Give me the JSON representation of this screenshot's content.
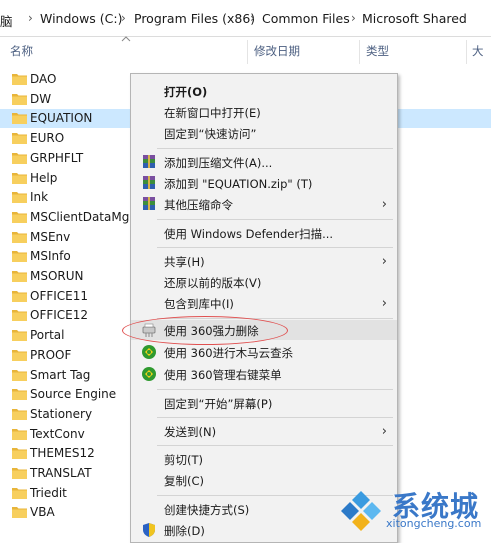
{
  "breadcrumb": [
    "脑",
    "Windows (C:)",
    "Program Files (x86)",
    "Common Files",
    "Microsoft Shared"
  ],
  "columns": {
    "name": "名称",
    "date": "修改日期",
    "type": "类型",
    "size": "大"
  },
  "folders": [
    "DAO",
    "DW",
    "EQUATION",
    "EURO",
    "GRPHFLT",
    "Help",
    "Ink",
    "MSClientDataMgr",
    "MSEnv",
    "MSInfo",
    "MSORUN",
    "OFFICE11",
    "OFFICE12",
    "Portal",
    "PROOF",
    "Smart Tag",
    "Source Engine",
    "Stationery",
    "TextConv",
    "THEMES12",
    "TRANSLAT",
    "Triedit",
    "VBA"
  ],
  "selected_folder": "EQUATION",
  "menu": {
    "open": "打开(O)",
    "open_new_window": "在新窗口中打开(E)",
    "pin_quick_access": "固定到“快速访问”",
    "add_archive": "添加到压缩文件(A)...",
    "add_zip": "添加到 \"EQUATION.zip\" (T)",
    "other_compress": "其他压缩命令",
    "defender": "使用 Windows Defender扫描...",
    "share": "共享(H)",
    "restore": "还原以前的版本(V)",
    "include_library": "包含到库中(I)",
    "force_delete": "使用 360强力删除",
    "trojan_scan": "使用 360进行木马云查杀",
    "manage_menu": "使用 360管理右键菜单",
    "pin_start": "固定到“开始”屏幕(P)",
    "send_to": "发送到(N)",
    "cut": "剪切(T)",
    "copy": "复制(C)",
    "create_shortcut": "创建快捷方式(S)",
    "delete": "删除(D)"
  },
  "watermark": {
    "main": "系统城",
    "sub": "xitongcheng.com"
  },
  "colors": {
    "selection": "#cce8ff",
    "folder": "#f7c84a",
    "highlight_oval": "#e05050",
    "watermark": "#3a78c8"
  }
}
